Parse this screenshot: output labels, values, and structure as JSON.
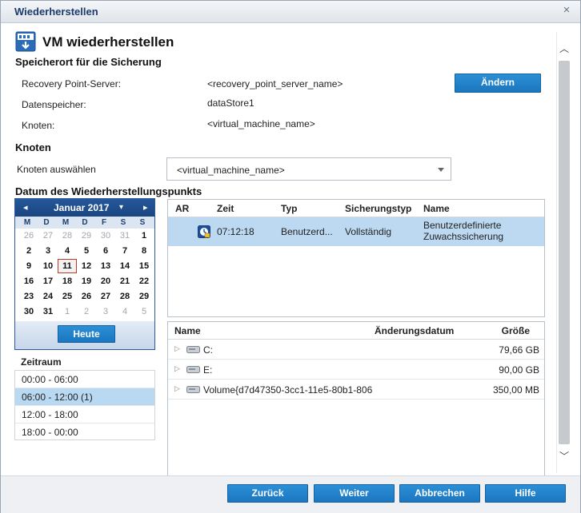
{
  "window": {
    "title": "Wiederherstellen"
  },
  "page": {
    "title": "VM wiederherstellen"
  },
  "location": {
    "heading": "Speicherort für die Sicherung",
    "rps_label": "Recovery Point-Server:",
    "rps_value": "<recovery_point_server_name>",
    "datastore_label": "Datenspeicher:",
    "datastore_value": "dataStore1",
    "node_label": "Knoten:",
    "node_value": "<virtual_machine_name>",
    "change_button": "Ändern"
  },
  "node": {
    "heading": "Knoten",
    "select_label": "Knoten auswählen",
    "selected": "<virtual_machine_name>"
  },
  "recovery_date": {
    "heading": "Datum des Wiederherstellungspunkts"
  },
  "calendar": {
    "prev": "◂",
    "next": "▸",
    "month": "Januar 2017",
    "month_dropdown": "▾",
    "weekdays": [
      "M",
      "D",
      "M",
      "D",
      "F",
      "S",
      "S"
    ],
    "weeks": [
      [
        "26",
        "27",
        "28",
        "29",
        "30",
        "31",
        "1"
      ],
      [
        "2",
        "3",
        "4",
        "5",
        "6",
        "7",
        "8"
      ],
      [
        "9",
        "10",
        "11",
        "12",
        "13",
        "14",
        "15"
      ],
      [
        "16",
        "17",
        "18",
        "19",
        "20",
        "21",
        "22"
      ],
      [
        "23",
        "24",
        "25",
        "26",
        "27",
        "28",
        "29"
      ],
      [
        "30",
        "31",
        "1",
        "2",
        "3",
        "4",
        "5"
      ]
    ],
    "selected_day": "11",
    "today_button": "Heute"
  },
  "timerange": {
    "heading": "Zeitraum",
    "items": [
      "00:00 - 06:00",
      "06:00 - 12:00   (1)",
      "12:00 - 18:00",
      "18:00 - 00:00"
    ],
    "selected_index": 1
  },
  "recovery_points": {
    "columns": [
      "AR",
      "Zeit",
      "Typ",
      "Sicherungstyp",
      "Name"
    ],
    "rows": [
      {
        "ar": "",
        "time": "07:12:18",
        "type": "Benutzerd...",
        "backup_type": "Vollständig",
        "name_line1": "Benutzerdefinierte",
        "name_line2": "Zuwachssicherung"
      }
    ]
  },
  "files": {
    "columns": [
      "Name",
      "Änderungsdatum",
      "Größe"
    ],
    "rows": [
      {
        "name": "C:",
        "date": "",
        "size": "79,66 GB"
      },
      {
        "name": "E:",
        "date": "",
        "size": "90,00 GB"
      },
      {
        "name": "Volume{d7d47350-3cc1-11e5-80b1-806",
        "date": "",
        "size": "350,00 MB"
      }
    ]
  },
  "footer": {
    "back": "Zurück",
    "next": "Weiter",
    "cancel": "Abbrechen",
    "help": "Hilfe"
  },
  "colors": {
    "accent": "#1a76c0",
    "title_text": "#1b3a6b",
    "selection": "#bcd9f1",
    "calendar_header": "#25579b"
  },
  "icons": {
    "window_close": "×",
    "scroll_up": "︿",
    "scroll_down": "﹀",
    "tree_expand": "▷"
  }
}
